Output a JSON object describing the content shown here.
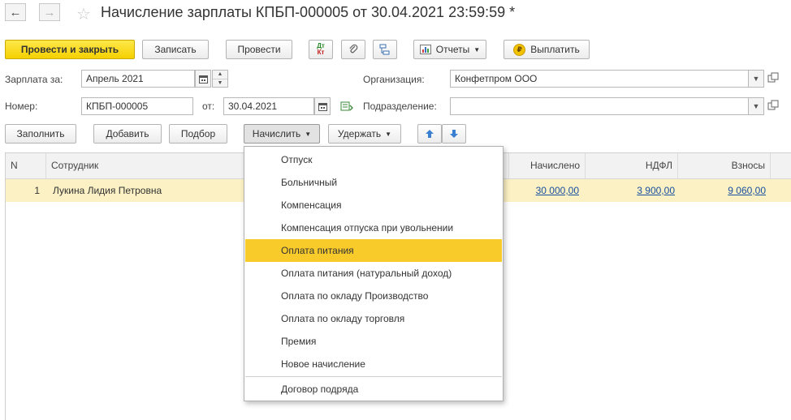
{
  "window": {
    "title": "Начисление зарплаты КПБП-000005 от 30.04.2021 23:59:59 *"
  },
  "icons": {
    "back": "arrow-left-icon",
    "forward": "arrow-right-icon",
    "favorite": "star-icon",
    "dt_kt": "Дт\nКт"
  },
  "toolbar": {
    "post_close": "Провести и закрыть",
    "save": "Записать",
    "post": "Провести",
    "dtkt_top": "Дт",
    "dtkt_bottom": "Кт",
    "reports": "Отчеты",
    "pay": "Выплатить"
  },
  "form": {
    "salary_for_label": "Зарплата за:",
    "salary_for_value": "Апрель 2021",
    "number_label": "Номер:",
    "number_value": "КПБП-000005",
    "date_label": "от:",
    "date_value": "30.04.2021",
    "org_label": "Организация:",
    "org_value": "Конфетпром ООО",
    "dept_label": "Подразделение:",
    "dept_value": ""
  },
  "table_toolbar": {
    "fill": "Заполнить",
    "add": "Добавить",
    "pick": "Подбор",
    "accrue": "Начислить",
    "withhold": "Удержать"
  },
  "table": {
    "columns": {
      "n": "N",
      "employee": "Сотрудник",
      "accrued": "Начислено",
      "ndfl": "НДФЛ",
      "contributions": "Взносы"
    },
    "rows": [
      {
        "n": "1",
        "employee": "Лукина Лидия Петровна",
        "accrued": "30 000,00",
        "ndfl": "3 900,00",
        "contributions": "9 060,00"
      }
    ]
  },
  "accrue_menu": {
    "items": [
      "Отпуск",
      "Больничный",
      "Компенсация",
      "Компенсация отпуска при увольнении",
      "Оплата питания",
      "Оплата питания (натуральный доход)",
      "Оплата по окладу Производство",
      "Оплата по окладу торговля",
      "Премия",
      "Новое начисление"
    ],
    "highlighted_index": 4,
    "after_separator": "Договор подряда"
  },
  "colors": {
    "primary_button": "#f5d000",
    "highlight": "#f8ca2a",
    "selected_row": "#fbf1c4",
    "link": "#1a4fa0"
  }
}
